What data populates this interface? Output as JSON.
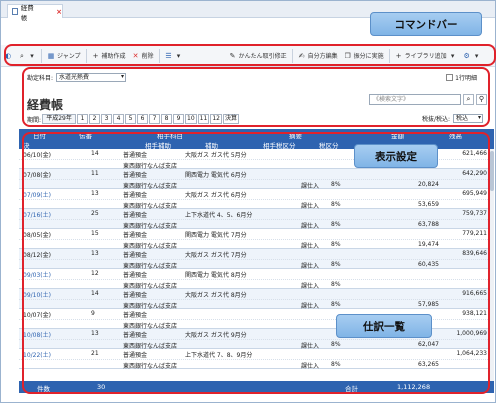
{
  "tab": {
    "title": "経費帳",
    "close": "×"
  },
  "toolbar": {
    "jump": "ジャンプ",
    "new": "補助作成",
    "delete": "削除",
    "easy_fix": "かんたん取引修正",
    "auto_edit": "自分方編集",
    "move": "振分に実施",
    "library": "ライブラリ追加"
  },
  "callouts": {
    "command": "コマンドバー",
    "display": "表示設定",
    "journal": "仕訳一覧"
  },
  "settings": {
    "account_label": "勘定科目:",
    "account_value": "水道光熱費",
    "checkbox_label": "1行明細",
    "title": "経費帳",
    "search_placeholder": "《検索文字》",
    "period_label": "期間:",
    "period_value": "平成29年",
    "months": [
      "1",
      "2",
      "3",
      "4",
      "5",
      "6",
      "7",
      "8",
      "9",
      "10",
      "11",
      "12",
      "決算"
    ],
    "tax_label": "税抜/税込:",
    "tax_value": "税込"
  },
  "table": {
    "headers": {
      "date": "日付",
      "slip": "伝番",
      "counter": "相手科目",
      "counter_sub": "相手補助",
      "summary": "摘要",
      "sub": "補助",
      "tax_class": "相手税区分",
      "tax_rate": "税区分",
      "amount": "金額",
      "balance": "残高",
      "kind": "決"
    },
    "rows": [
      {
        "date": "06/10(金)",
        "no": "14",
        "acct": "普通預金",
        "bank": "東西銀行なんば支店",
        "summary": "大阪ガス ガス代 5月分",
        "tax": "",
        "rate": "",
        "amount": "",
        "balance": "621,466",
        "sat": false
      },
      {
        "date": "07/08(金)",
        "no": "11",
        "acct": "普通預金",
        "bank": "東西銀行なんば支店",
        "summary": "関西電力 電気代 6月分",
        "tax": "課仕入",
        "rate": "8%",
        "amount": "20,824",
        "balance": "642,290",
        "sat": false
      },
      {
        "date": "07/09(土)",
        "no": "13",
        "acct": "普通預金",
        "bank": "東西銀行なんば支店",
        "summary": "大阪ガス ガス代 6月分",
        "tax": "課仕入",
        "rate": "8%",
        "amount": "53,659",
        "balance": "695,949",
        "sat": true
      },
      {
        "date": "07/16(土)",
        "no": "25",
        "acct": "普通預金",
        "bank": "東西銀行なんば支店",
        "summary": "上下水道代 4、5、6月分",
        "tax": "課仕入",
        "rate": "8%",
        "amount": "63,788",
        "balance": "759,737",
        "sat": true
      },
      {
        "date": "08/05(金)",
        "no": "15",
        "acct": "普通預金",
        "bank": "東西銀行なんば支店",
        "summary": "関西電力 電気代 7月分",
        "tax": "課仕入",
        "rate": "8%",
        "amount": "19,474",
        "balance": "779,211",
        "sat": false
      },
      {
        "date": "08/12(金)",
        "no": "13",
        "acct": "普通預金",
        "bank": "東西銀行なんば支店",
        "summary": "大阪ガス ガス代 7月分",
        "tax": "課仕入",
        "rate": "8%",
        "amount": "60,435",
        "balance": "839,646",
        "sat": false
      },
      {
        "date": "09/03(土)",
        "no": "12",
        "acct": "普通預金",
        "bank": "東西銀行なんば支店",
        "summary": "関西電力 電気代 8月分",
        "tax": "課仕入",
        "rate": "8%",
        "amount": "",
        "balance": "",
        "sat": true
      },
      {
        "date": "09/10(土)",
        "no": "14",
        "acct": "普通預金",
        "bank": "東西銀行なんば支店",
        "summary": "大阪ガス ガス代 8月分",
        "tax": "課仕入",
        "rate": "8%",
        "amount": "57,985",
        "balance": "916,665",
        "sat": true
      },
      {
        "date": "10/07(金)",
        "no": "9",
        "acct": "普通預金",
        "bank": "東西銀行なんば支店",
        "summary": "",
        "tax": "",
        "rate": "",
        "amount": "",
        "balance": "938,121",
        "sat": false
      },
      {
        "date": "10/08(土)",
        "no": "13",
        "acct": "普通預金",
        "bank": "東西銀行なんば支店",
        "summary": "大阪ガス ガス代 9月分",
        "tax": "課仕入",
        "rate": "8%",
        "amount": "62,047",
        "balance": "1,000,969",
        "sat": true
      },
      {
        "date": "10/22(土)",
        "no": "21",
        "acct": "普通預金",
        "bank": "東西銀行なんば支店",
        "summary": "上下水道代 7、8、9月分",
        "tax": "課仕入",
        "rate": "8%",
        "amount": "63,265",
        "balance": "1,064,233",
        "sat": true
      }
    ],
    "footer": {
      "count_label": "件数",
      "count": "30",
      "total_label": "合計",
      "total": "1,112,268"
    }
  },
  "colors": {
    "accent": "#2e63b0",
    "highlight": "#e0222b",
    "callout": "#8fc0ec"
  }
}
